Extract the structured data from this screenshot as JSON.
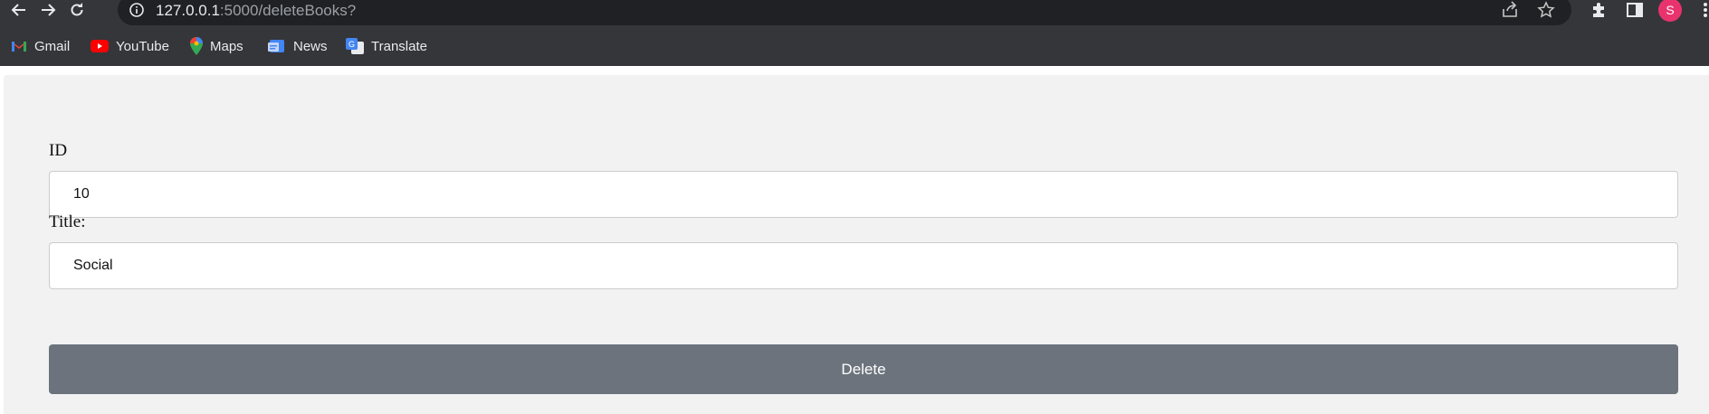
{
  "browser": {
    "url_host": "127.0.0.1",
    "url_path": ":5000/deleteBooks?",
    "avatar_letter": "S",
    "bookmarks": [
      {
        "label": "Gmail",
        "icon": "gmail-icon"
      },
      {
        "label": "YouTube",
        "icon": "youtube-icon"
      },
      {
        "label": "Maps",
        "icon": "maps-icon"
      },
      {
        "label": "News",
        "icon": "news-icon"
      },
      {
        "label": "Translate",
        "icon": "translate-icon"
      }
    ]
  },
  "form": {
    "id_label": "ID",
    "id_value": "10",
    "title_label": "Title:",
    "title_value": "Social",
    "submit_label": "Delete"
  },
  "colors": {
    "chrome_bg": "#35363a",
    "panel_bg": "#f2f2f2",
    "button_bg": "#6c737c",
    "avatar_bg": "#e8336d"
  }
}
